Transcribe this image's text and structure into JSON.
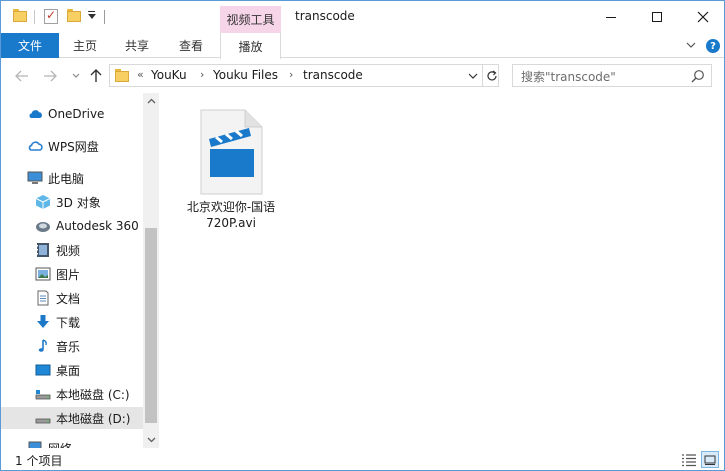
{
  "window": {
    "title": "transcode",
    "context_tab_group": "视频工具"
  },
  "ribbon": {
    "file_tab": "文件",
    "tabs": [
      {
        "label": "主页"
      },
      {
        "label": "共享"
      },
      {
        "label": "查看"
      },
      {
        "label": "播放"
      }
    ],
    "help_label": "?"
  },
  "address": {
    "overflow": "«",
    "crumbs": [
      "YouKu",
      "Youku Files",
      "transcode"
    ],
    "separator": "›"
  },
  "search": {
    "placeholder": "搜索\"transcode\""
  },
  "sidebar": {
    "items": [
      {
        "label": "OneDrive",
        "icon": "cloud-icon"
      },
      {
        "label": "WPS网盘",
        "icon": "cloud-icon"
      },
      {
        "label": "此电脑",
        "icon": "computer-icon"
      },
      {
        "label": "3D 对象",
        "icon": "cube-icon"
      },
      {
        "label": "Autodesk 360",
        "icon": "autodesk-icon"
      },
      {
        "label": "视频",
        "icon": "video-icon"
      },
      {
        "label": "图片",
        "icon": "picture-icon"
      },
      {
        "label": "文档",
        "icon": "document-icon"
      },
      {
        "label": "下载",
        "icon": "download-icon"
      },
      {
        "label": "音乐",
        "icon": "music-icon"
      },
      {
        "label": "桌面",
        "icon": "desktop-icon"
      },
      {
        "label": "本地磁盘 (C:)",
        "icon": "drive-icon"
      },
      {
        "label": "本地磁盘 (D:)",
        "icon": "drive-icon",
        "selected": true
      },
      {
        "label": "网络",
        "icon": "network-icon"
      }
    ]
  },
  "files": [
    {
      "name_line1": "北京欢迎你-国语",
      "name_line2": "720P.avi",
      "icon": "video-file-icon"
    }
  ],
  "status": {
    "item_count": "1 个项目"
  },
  "colors": {
    "accent": "#1979ca",
    "context_tab": "#f6d5e8",
    "selection": "#e5e5e5"
  }
}
